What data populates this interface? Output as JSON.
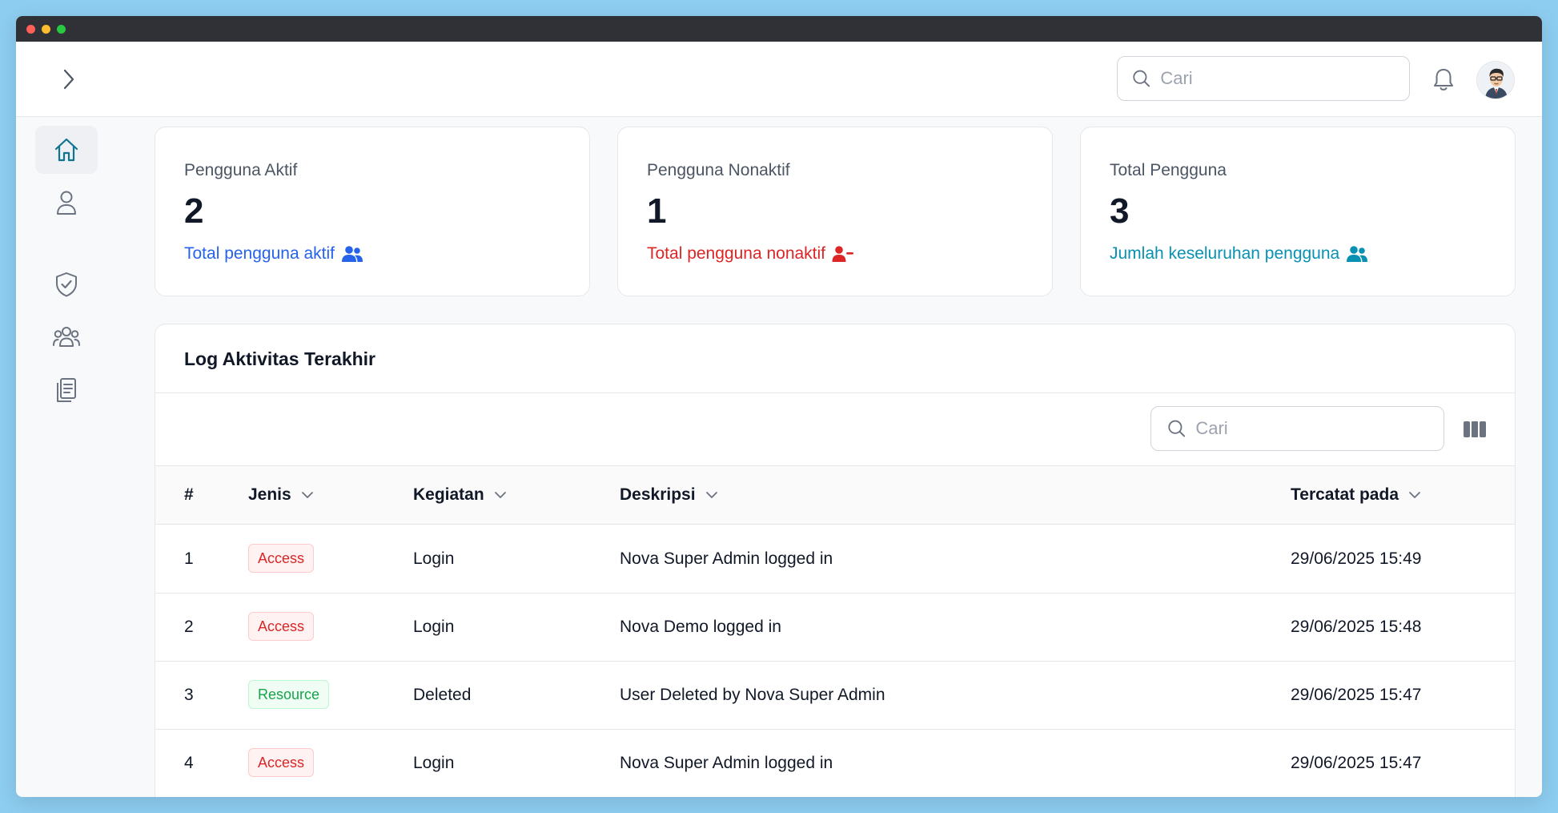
{
  "topbar": {
    "search_placeholder": "Cari"
  },
  "stats": [
    {
      "title": "Pengguna Aktif",
      "value": "2",
      "subtitle": "Total pengguna aktif",
      "color": "#2563eb",
      "icon": "users-icon"
    },
    {
      "title": "Pengguna Nonaktif",
      "value": "1",
      "subtitle": "Total pengguna nonaktif",
      "color": "#dc2626",
      "icon": "user-minus-icon"
    },
    {
      "title": "Total Pengguna",
      "value": "3",
      "subtitle": "Jumlah keseluruhan pengguna",
      "color": "#0891b2",
      "icon": "users-icon"
    }
  ],
  "sidebar": {
    "items": [
      {
        "icon": "home-icon",
        "active": true
      },
      {
        "icon": "user-icon",
        "active": false
      },
      {
        "icon": "shield-check-icon",
        "active": false
      },
      {
        "icon": "users-group-icon",
        "active": false
      },
      {
        "icon": "clipboard-icon",
        "active": false
      }
    ]
  },
  "log": {
    "title": "Log Aktivitas Terakhir",
    "search_placeholder": "Cari",
    "columns": [
      "#",
      "Jenis",
      "Kegiatan",
      "Deskripsi",
      "Tercatat pada"
    ],
    "rows": [
      {
        "num": "1",
        "jenis": "Access",
        "kegiatan": "Login",
        "deskripsi": "Nova Super Admin logged in",
        "tercatat": "29/06/2025 15:49"
      },
      {
        "num": "2",
        "jenis": "Access",
        "kegiatan": "Login",
        "deskripsi": "Nova Demo logged in",
        "tercatat": "29/06/2025 15:48"
      },
      {
        "num": "3",
        "jenis": "Resource",
        "kegiatan": "Deleted",
        "deskripsi": "User Deleted by Nova Super Admin",
        "tercatat": "29/06/2025 15:47"
      },
      {
        "num": "4",
        "jenis": "Access",
        "kegiatan": "Login",
        "deskripsi": "Nova Super Admin logged in",
        "tercatat": "29/06/2025 15:47"
      }
    ]
  },
  "colors": {
    "accent": "#0e7490",
    "access_badge": "#dc2626",
    "resource_badge": "#16a34a"
  }
}
